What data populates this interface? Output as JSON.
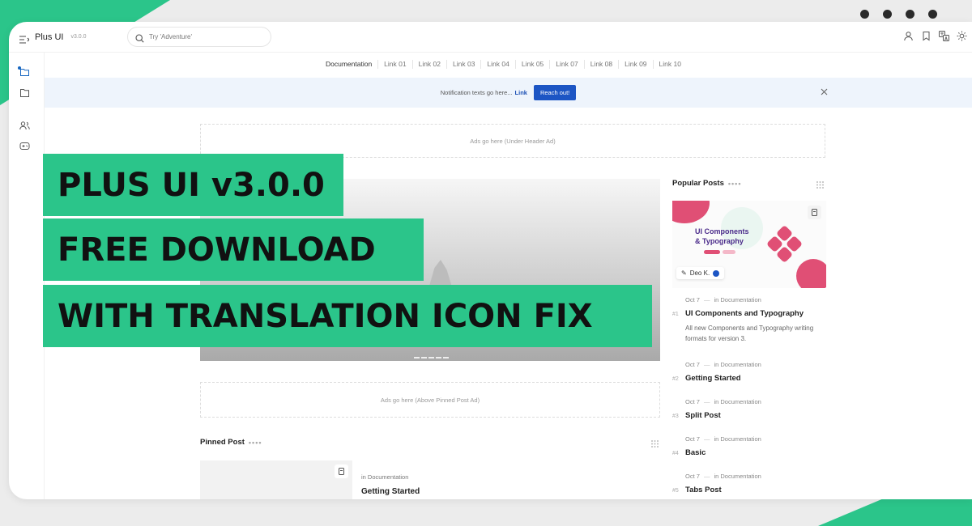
{
  "app": {
    "name": "Plus UI",
    "version": "v3.0.0"
  },
  "search": {
    "placeholder": "Try 'Adventure'"
  },
  "nav": {
    "links": [
      "Documentation",
      "Link 01",
      "Link 02",
      "Link 03",
      "Link 04",
      "Link 05",
      "Link 07",
      "Link 08",
      "Link 09",
      "Link 10"
    ]
  },
  "notification": {
    "text": "Notification texts go here...",
    "link": "Link",
    "button": "Reach out!"
  },
  "ads": {
    "under_header": "Ads go here (Under Header Ad)",
    "above_pinned": "Ads go here (Above Pinned Post Ad)"
  },
  "popular": {
    "title": "Popular Posts",
    "image_title_line1": "UI Components",
    "image_title_line2": "& Typography",
    "author": "Deo K.",
    "items": [
      {
        "date": "Oct 7",
        "category": "in Documentation",
        "num": "#1",
        "title": "UI Components and Typography",
        "desc": "All new Components and Typography writing formats for version 3."
      },
      {
        "date": "Oct 7",
        "category": "in Documentation",
        "num": "#2",
        "title": "Getting Started"
      },
      {
        "date": "Oct 7",
        "category": "in Documentation",
        "num": "#3",
        "title": "Split Post"
      },
      {
        "date": "Oct 7",
        "category": "in Documentation",
        "num": "#4",
        "title": "Basic"
      },
      {
        "date": "Oct 7",
        "category": "in Documentation",
        "num": "#5",
        "title": "Tabs Post"
      }
    ]
  },
  "pinned": {
    "title": "Pinned Post",
    "category": "in Documentation",
    "post_title": "Getting Started"
  },
  "banner": {
    "line1": "PLUS UI v3.0.0",
    "line2": "FREE DOWNLOAD",
    "line3": "WITH TRANSLATION ICON FIX"
  },
  "colors": {
    "accent_green": "#2bc58a",
    "link_blue": "#1c55c4",
    "pink": "#e04f75"
  }
}
